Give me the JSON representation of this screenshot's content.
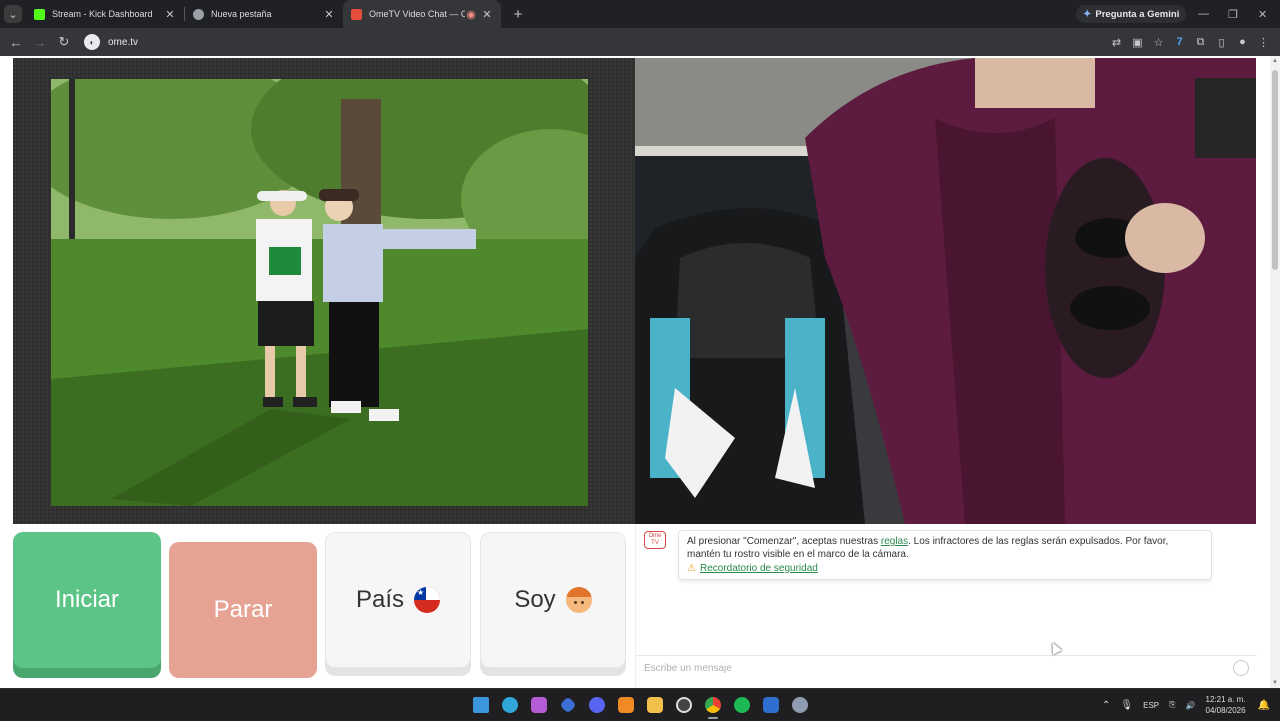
{
  "browser": {
    "tabs": [
      {
        "title": "Stream - Kick Dashboard",
        "favicon_color": "#53fc18",
        "active": false
      },
      {
        "title": "Nueva pestaña",
        "favicon_color": "#9aa0a6",
        "active": false
      },
      {
        "title": "OmeTV Video Chat — Ome",
        "favicon_color": "#e74c3c",
        "active": true
      }
    ],
    "gemini_label": "Pregunta a Gemini",
    "url": "ome.tv"
  },
  "controls": {
    "start_label": "Iniciar",
    "stop_label": "Parar",
    "country_label": "País",
    "gender_label": "Soy"
  },
  "chat": {
    "logo_text": "Ome TV",
    "notice_prefix": "Al presionar \"Comenzar\", aceptas nuestras",
    "notice_link": "reglas",
    "notice_suffix": ". Los infractores de las reglas serán expulsados. Por favor, mantén tu rostro visible en el marco de la cámara.",
    "safety_link": "Recordatorio de seguridad",
    "placeholder": "Escribe un mensaje"
  },
  "taskbar": {
    "language": "ESP",
    "time": "12:21 a. m.",
    "date": "04/08/2026"
  },
  "colors": {
    "start": "#5cc487",
    "stop": "#e6a394",
    "link": "#2b8a4f"
  }
}
